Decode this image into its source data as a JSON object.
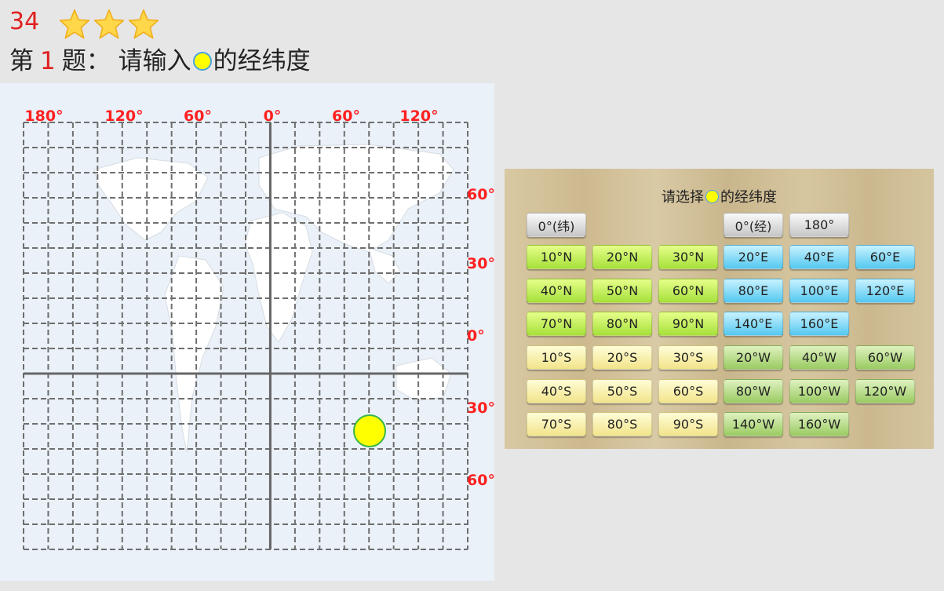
{
  "header": {
    "score": "34",
    "stars": 3,
    "question_prefix": "第",
    "question_number": "1",
    "question_middle": "题：  请输入",
    "question_suffix": "的经纬度"
  },
  "map": {
    "top_labels": [
      "180°",
      "120°",
      "60°",
      "0°",
      "60°",
      "120°"
    ],
    "right_labels": [
      "60°",
      "30°",
      "0°",
      "30°",
      "60°"
    ],
    "label_color": "#ff2020",
    "marker_color": "#ffff00",
    "marker_border": "#39b54a"
  },
  "quiz": {
    "title_prefix": "请选择",
    "title_suffix": "的经纬度",
    "rows": [
      [
        {
          "label": "0°(纬)",
          "style": "gray"
        },
        null,
        null,
        {
          "label": "0°(经)",
          "style": "gray"
        },
        {
          "label": "180°",
          "style": "gray"
        },
        null
      ],
      [
        {
          "label": "10°N",
          "style": "lime"
        },
        {
          "label": "20°N",
          "style": "lime"
        },
        {
          "label": "30°N",
          "style": "lime"
        },
        {
          "label": "20°E",
          "style": "cyan"
        },
        {
          "label": "40°E",
          "style": "cyan"
        },
        {
          "label": "60°E",
          "style": "cyan"
        }
      ],
      [
        {
          "label": "40°N",
          "style": "lime"
        },
        {
          "label": "50°N",
          "style": "lime"
        },
        {
          "label": "60°N",
          "style": "lime"
        },
        {
          "label": "80°E",
          "style": "cyan"
        },
        {
          "label": "100°E",
          "style": "cyan"
        },
        {
          "label": "120°E",
          "style": "cyan"
        }
      ],
      [
        {
          "label": "70°N",
          "style": "lime"
        },
        {
          "label": "80°N",
          "style": "lime"
        },
        {
          "label": "90°N",
          "style": "lime"
        },
        {
          "label": "140°E",
          "style": "cyan"
        },
        {
          "label": "160°E",
          "style": "cyan"
        },
        null
      ],
      [
        {
          "label": "10°S",
          "style": "cream"
        },
        {
          "label": "20°S",
          "style": "cream"
        },
        {
          "label": "30°S",
          "style": "cream"
        },
        {
          "label": "20°W",
          "style": "green"
        },
        {
          "label": "40°W",
          "style": "green"
        },
        {
          "label": "60°W",
          "style": "green"
        }
      ],
      [
        {
          "label": "40°S",
          "style": "cream"
        },
        {
          "label": "50°S",
          "style": "cream"
        },
        {
          "label": "60°S",
          "style": "cream"
        },
        {
          "label": "80°W",
          "style": "green"
        },
        {
          "label": "100°W",
          "style": "green"
        },
        {
          "label": "120°W",
          "style": "green"
        }
      ],
      [
        {
          "label": "70°S",
          "style": "cream"
        },
        {
          "label": "80°S",
          "style": "cream"
        },
        {
          "label": "90°S",
          "style": "cream"
        },
        {
          "label": "140°W",
          "style": "green"
        },
        {
          "label": "160°W",
          "style": "green"
        },
        null
      ]
    ]
  }
}
